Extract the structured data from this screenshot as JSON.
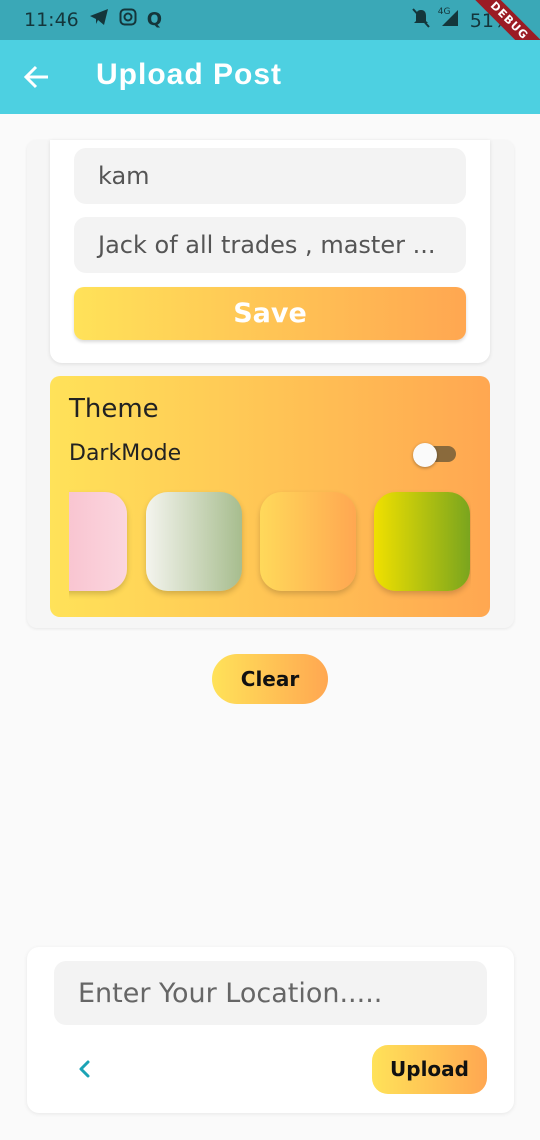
{
  "status_bar": {
    "time": "11:46",
    "battery": "51%",
    "network": "4G",
    "left_icons": [
      "telegram-icon",
      "instagram-icon",
      "q-app-icon"
    ],
    "right_icons": [
      "mute-bell-icon",
      "signal-icon",
      "battery-icon"
    ],
    "debug_banner": "DEBUG"
  },
  "app_bar": {
    "title": "Upload Post",
    "background": "#4dd0e1"
  },
  "profile": {
    "name_value": "kam",
    "bio_value": "Jack of all trades , master ...",
    "save_label": "Save"
  },
  "theme": {
    "title": "Theme",
    "dark_mode_label": "DarkMode",
    "dark_mode_on": false,
    "gradient": [
      "#ffe259",
      "#ffa751"
    ],
    "swatches": [
      {
        "name": "pink",
        "colors": [
          "#f7bac8",
          "#fbd6df"
        ]
      },
      {
        "name": "sage",
        "colors": [
          "#f4f4ee",
          "#a7bd8e"
        ]
      },
      {
        "name": "orange",
        "colors": [
          "#ffd95a",
          "#ffa751"
        ]
      },
      {
        "name": "lime",
        "colors": [
          "#f0e000",
          "#7aa51e"
        ]
      }
    ]
  },
  "actions": {
    "clear_label": "Clear",
    "upload_label": "Upload"
  },
  "location": {
    "placeholder": "Enter Your Location....."
  }
}
